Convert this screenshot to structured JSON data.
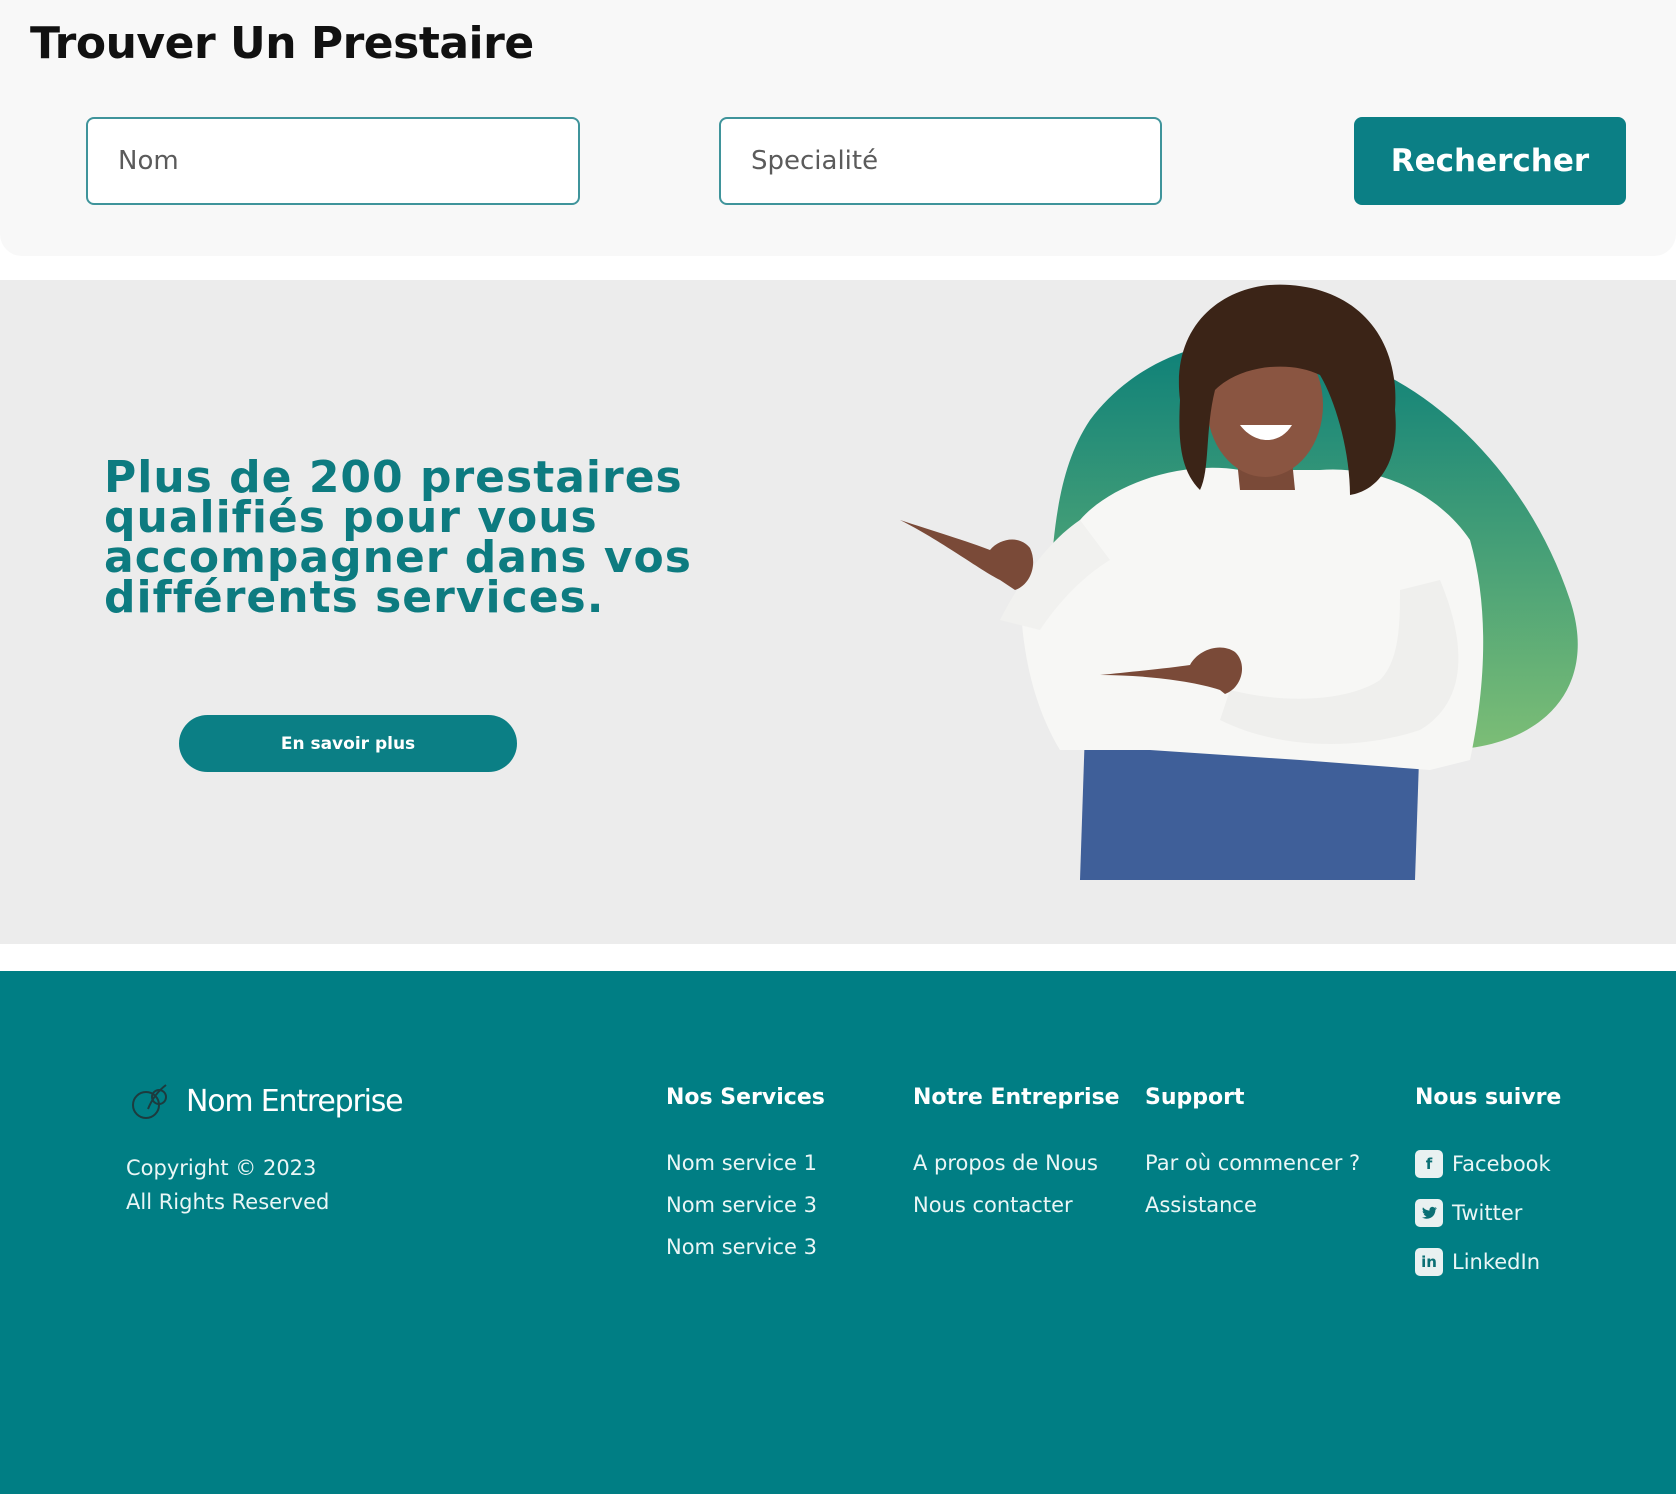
{
  "search": {
    "title": "Trouver Un Prestaire",
    "name_placeholder": "Nom",
    "specialty_placeholder": "Specialité",
    "button_label": "Rechercher"
  },
  "hero": {
    "headline": "Plus de 200 prestaires qualifiés pour vous accompagner dans vos différents services.",
    "cta_label": "En savoir plus"
  },
  "footer": {
    "brand_name": "Nom Entreprise",
    "copyright": "Copyright © 2023",
    "rights": "All Rights Reserved",
    "columns": {
      "services": {
        "title": "Nos Services",
        "links": [
          "Nom service 1",
          "Nom service 3",
          "Nom service 3"
        ]
      },
      "company": {
        "title": "Notre Entreprise",
        "links": [
          "A propos de Nous",
          "Nous contacter"
        ]
      },
      "support": {
        "title": "Support",
        "links": [
          "Par où commencer ?",
          "Assistance"
        ]
      },
      "social": {
        "title": "Nous suivre",
        "links": [
          {
            "label": "Facebook",
            "icon": "facebook-icon",
            "glyph": "f"
          },
          {
            "label": "Twitter",
            "icon": "twitter-icon",
            "glyph": "t"
          },
          {
            "label": "LinkedIn",
            "icon": "linkedin-icon",
            "glyph": "in"
          }
        ]
      }
    }
  },
  "colors": {
    "accent": "#0b7f85",
    "footer_bg": "#007e84",
    "hero_bg": "#ececec",
    "headline": "#0d7b80"
  }
}
